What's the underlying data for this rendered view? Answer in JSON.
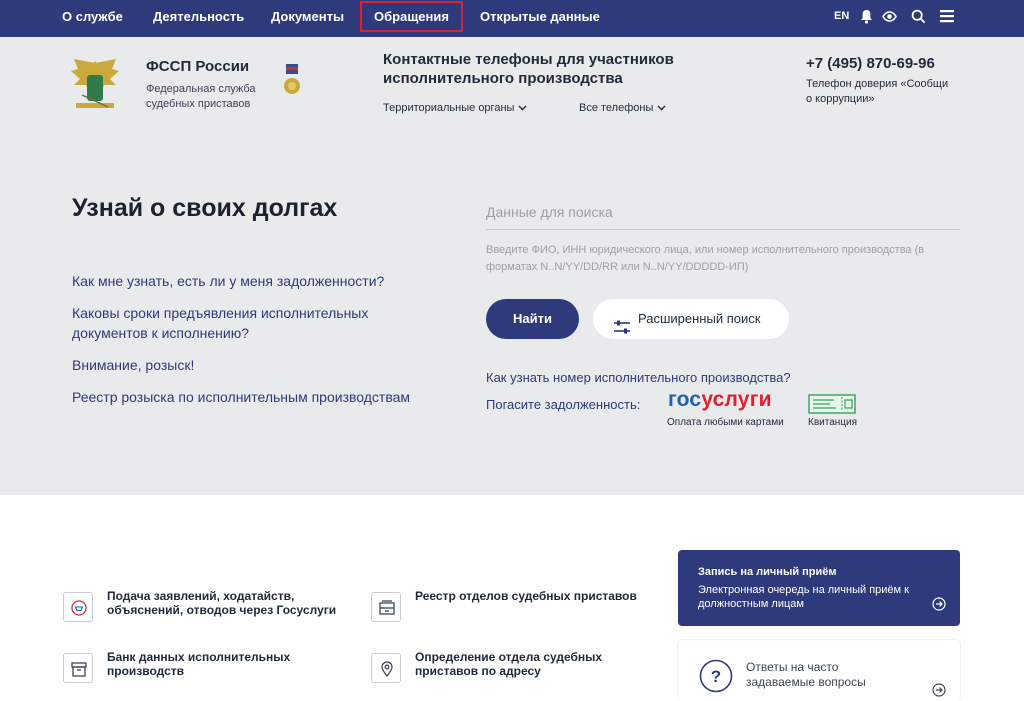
{
  "nav": {
    "items": [
      "О службе",
      "Деятельность",
      "Документы",
      "Обращения",
      "Открытые данные"
    ],
    "lang": "EN"
  },
  "header": {
    "org_name": "ФССП России",
    "org_subtitle": "Федеральная служба судебных приставов",
    "contacts_title": "Контактные телефоны для участников исполнительного производства",
    "dropdown_territorial": "Территориальные органы",
    "dropdown_all_phones": "Все телефоны",
    "phone": "+7 (495) 870-69-96",
    "trust_line": "Телефон доверия «Сообщи о коррупции»"
  },
  "debts": {
    "title": "Узнай о своих долгах",
    "links": [
      "Как мне узнать, есть ли у меня задолженности?",
      "Каковы сроки предъявления исполнительных документов к исполнению?",
      "Внимание, розыск!",
      "Реестр розыска по исполнительным производствам"
    ],
    "search_placeholder": "Данные для поиска",
    "search_hint": "Введите ФИО, ИНН юридического лица, или номер исполнительного производства (в форматах N..N/YY/DD/RR или N..N/YY/DDDDD-ИП)",
    "find_button": "Найти",
    "advanced_button": "Расширенный поиск",
    "howto_link": "Как узнать номер исполнительного производства?",
    "pay_label": "Погасите задолженность:",
    "gosuslugi_part1": "гос",
    "gosuslugi_part2": "услуги",
    "gosuslugi_caption": "Оплата любыми картами",
    "receipt_caption": "Квитанция"
  },
  "services": {
    "items": [
      "Подача заявлений, ходатайств, объяснений, отводов через Госуслуги",
      "Реестр отделов судебных приставов",
      "Банк данных исполнительных производств",
      "Определение отдела судебных приставов по адресу"
    ],
    "appointment_title": "Запись на личный приём",
    "appointment_desc": "Электронная очередь на личный приём к должностным лицам",
    "faq_label": "Ответы на часто задаваемые вопросы"
  },
  "colors": {
    "primary": "#2e3a7c",
    "highlight": "#e0202e",
    "hero_bg": "#e9eaeb",
    "gosuslugi_blue": "#2060b4",
    "gosuslugi_red": "#e0202e"
  },
  "icons": {
    "nav_tools": [
      "bell-icon",
      "eye-icon",
      "search-icon",
      "menu-icon"
    ],
    "advanced_search": "sliders-icon",
    "services": [
      "gosuslugi-doc-icon",
      "drawer-icon",
      "archive-box-icon",
      "map-pin-icon"
    ],
    "appointment": "arrow-right-circle-icon",
    "faq": "question-circle-icon"
  }
}
